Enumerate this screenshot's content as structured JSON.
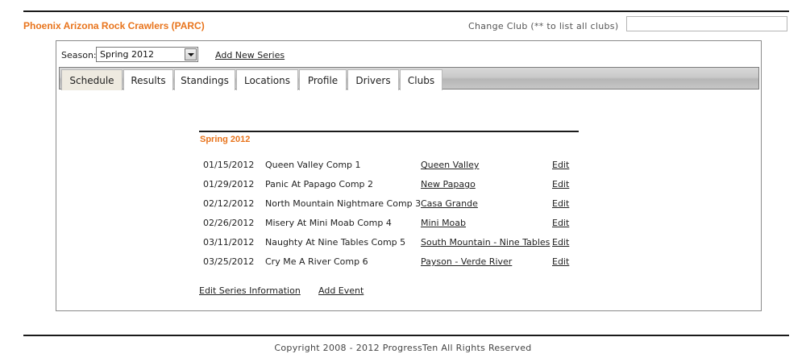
{
  "header": {
    "club_name": "Phoenix Arizona Rock Crawlers (PARC)",
    "change_club_label": "Change Club (** to list all clubs)",
    "change_club_value": ""
  },
  "season": {
    "label": "Season:",
    "selected": "Spring 2012",
    "add_series_label": "Add New Series"
  },
  "tabs": [
    {
      "label": "Schedule",
      "active": true
    },
    {
      "label": "Results",
      "active": false
    },
    {
      "label": "Standings",
      "active": false
    },
    {
      "label": "Locations",
      "active": false
    },
    {
      "label": "Profile",
      "active": false
    },
    {
      "label": "Drivers",
      "active": false
    },
    {
      "label": "Clubs",
      "active": false
    }
  ],
  "schedule": {
    "title": "Spring 2012",
    "events": [
      {
        "date": "01/15/2012",
        "name": "Queen Valley Comp 1",
        "location": "Queen Valley",
        "edit": "Edit"
      },
      {
        "date": "01/29/2012",
        "name": "Panic At Papago Comp 2",
        "location": "New Papago",
        "edit": "Edit"
      },
      {
        "date": "02/12/2012",
        "name": "North Mountain Nightmare Comp 3",
        "location": "Casa Grande",
        "edit": "Edit"
      },
      {
        "date": "02/26/2012",
        "name": "Misery At Mini Moab Comp 4",
        "location": "Mini Moab",
        "edit": "Edit"
      },
      {
        "date": "03/11/2012",
        "name": "Naughty At Nine Tables Comp 5",
        "location": "South Mountain - Nine Tables",
        "edit": "Edit"
      },
      {
        "date": "03/25/2012",
        "name": "Cry Me A River Comp 6",
        "location": "Payson - Verde River",
        "edit": "Edit"
      }
    ],
    "edit_series_label": "Edit Series Information",
    "add_event_label": "Add Event"
  },
  "footer": {
    "copyright": "Copyright 2008 - 2012 ProgressTen All Rights Reserved"
  },
  "colors": {
    "accent": "#e8741c",
    "rule": "#1a1a1a",
    "active_tab": "#eeeae0"
  }
}
